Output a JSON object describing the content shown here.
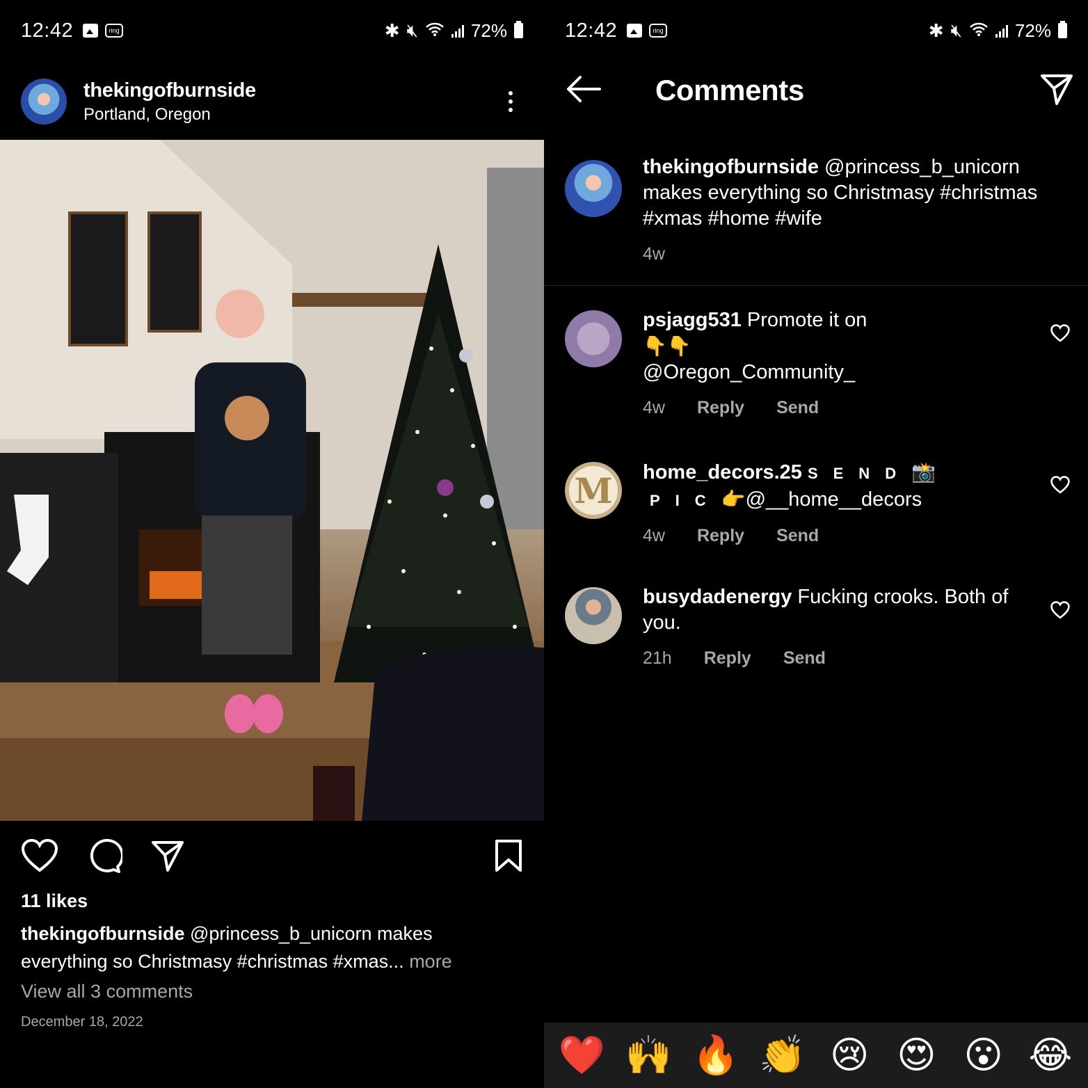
{
  "status_bar": {
    "time": "12:42",
    "ring_label": "ring",
    "battery": "72%"
  },
  "post": {
    "username": "thekingofburnside",
    "location": "Portland, Oregon",
    "likes": "11 likes",
    "caption_user": "thekingofburnside",
    "caption_text": " @princess_b_unicorn makes everything so Christmasy #christmas #xmas",
    "caption_ellipsis": "... ",
    "caption_more": "more",
    "view_all": "View all 3 comments",
    "date": "December 18, 2022"
  },
  "comments_screen": {
    "title": "Comments",
    "caption": {
      "username": "thekingofburnside",
      "text": " @princess_b_unicorn makes  everything so Christmasy #christmas #xmas #home #wife",
      "age": "4w"
    },
    "comments": [
      {
        "username": "psjagg531",
        "text": " Promote it on",
        "emoji": "👇👇",
        "text2": "@Oregon_Community_",
        "age": "4w",
        "reply": "Reply",
        "send": "Send"
      },
      {
        "username": "home_decors.25",
        "avatar_letter": "M",
        "spaced_1": "SEND",
        "emoji_1": "📸",
        "spaced_2": "PIC",
        "emoji_2": "👉",
        "text": "@__home__decors",
        "age": "4w",
        "reply": "Reply",
        "send": "Send"
      },
      {
        "username": "busydadenergy",
        "text": " Fucking crooks. Both of you.",
        "age": "21h",
        "reply": "Reply",
        "send": "Send"
      }
    ]
  },
  "reaction_bar": [
    "❤️",
    "🙌",
    "🔥",
    "👏",
    "😢",
    "😍",
    "😮",
    "😂"
  ]
}
